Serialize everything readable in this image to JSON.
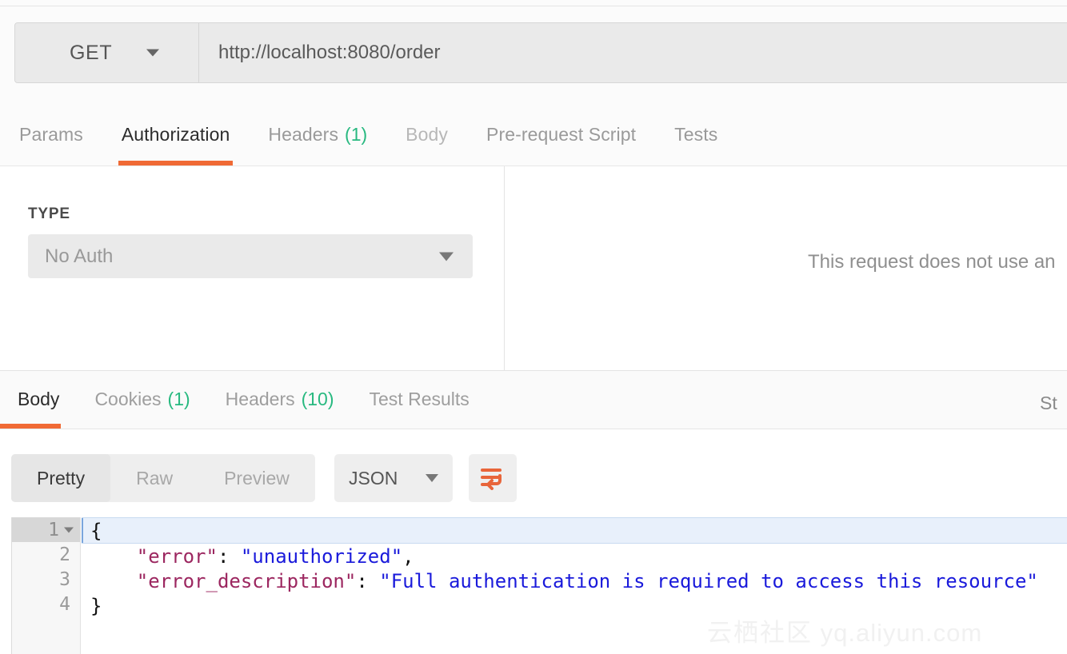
{
  "request": {
    "method": "GET",
    "url": "http://localhost:8080/order",
    "tabs": [
      {
        "label": "Params",
        "count": "",
        "state": "normal"
      },
      {
        "label": "Authorization",
        "count": "",
        "state": "active"
      },
      {
        "label": "Headers",
        "count": "(1)",
        "state": "normal"
      },
      {
        "label": "Body",
        "count": "",
        "state": "dim"
      },
      {
        "label": "Pre-request Script",
        "count": "",
        "state": "normal"
      },
      {
        "label": "Tests",
        "count": "",
        "state": "normal"
      }
    ],
    "auth": {
      "type_label": "TYPE",
      "type_value": "No Auth",
      "note": "This request does not use an"
    }
  },
  "response": {
    "tabs": [
      {
        "label": "Body",
        "count": "",
        "state": "active"
      },
      {
        "label": "Cookies",
        "count": "(1)",
        "state": "normal"
      },
      {
        "label": "Headers",
        "count": "(10)",
        "state": "normal"
      },
      {
        "label": "Test Results",
        "count": "",
        "state": "normal"
      }
    ],
    "status_truncated": "St",
    "toolbar": {
      "views": [
        {
          "label": "Pretty",
          "state": "active"
        },
        {
          "label": "Raw",
          "state": "normal"
        },
        {
          "label": "Preview",
          "state": "normal"
        }
      ],
      "format": "JSON",
      "wrap_icon": "word-wrap-icon"
    },
    "body": {
      "lines": [
        {
          "num": "1",
          "current": true,
          "foldable": true,
          "tokens": [
            {
              "t": "{",
              "c": "p"
            }
          ]
        },
        {
          "num": "2",
          "current": false,
          "foldable": false,
          "tokens": [
            {
              "t": "    \"error\"",
              "c": "k"
            },
            {
              "t": ": ",
              "c": "p"
            },
            {
              "t": "\"unauthorized\"",
              "c": "v"
            },
            {
              "t": ",",
              "c": "p"
            }
          ]
        },
        {
          "num": "3",
          "current": false,
          "foldable": false,
          "tokens": [
            {
              "t": "    \"error_description\"",
              "c": "k"
            },
            {
              "t": ": ",
              "c": "p"
            },
            {
              "t": "\"Full authentication is required to access this resource\"",
              "c": "v"
            }
          ]
        },
        {
          "num": "4",
          "current": false,
          "foldable": false,
          "tokens": [
            {
              "t": "}",
              "c": "p"
            }
          ]
        }
      ]
    }
  },
  "watermark": {
    "zh": "云栖社区",
    "en": "yq.aliyun.com"
  },
  "colors": {
    "accent_orange": "#f06a35",
    "count_green": "#28b980",
    "json_key": "#9c2760",
    "json_value": "#1a1adb",
    "toolbar_bg": "#eeeeee"
  }
}
